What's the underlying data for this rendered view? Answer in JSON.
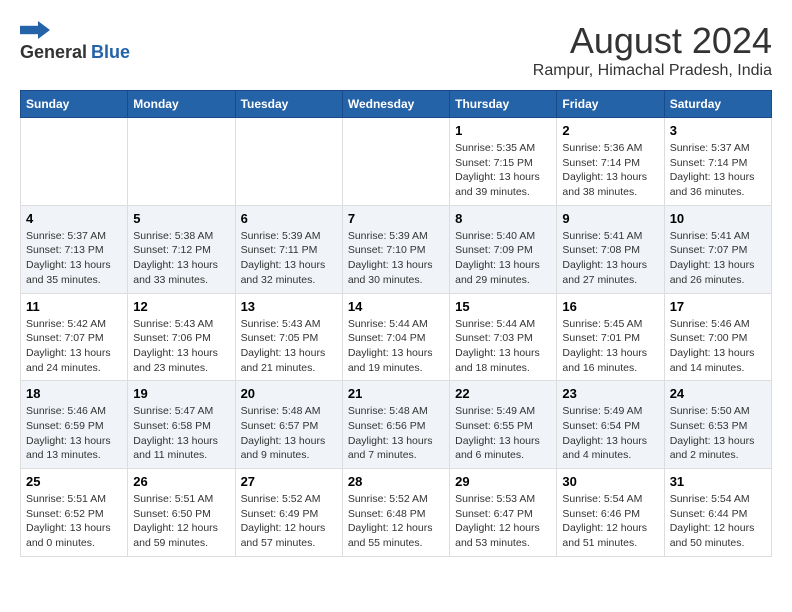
{
  "logo": {
    "general": "General",
    "blue": "Blue"
  },
  "title": "August 2024",
  "subtitle": "Rampur, Himachal Pradesh, India",
  "days_of_week": [
    "Sunday",
    "Monday",
    "Tuesday",
    "Wednesday",
    "Thursday",
    "Friday",
    "Saturday"
  ],
  "weeks": [
    {
      "days": [
        {
          "number": "",
          "sunrise": "",
          "sunset": "",
          "daylight": ""
        },
        {
          "number": "",
          "sunrise": "",
          "sunset": "",
          "daylight": ""
        },
        {
          "number": "",
          "sunrise": "",
          "sunset": "",
          "daylight": ""
        },
        {
          "number": "",
          "sunrise": "",
          "sunset": "",
          "daylight": ""
        },
        {
          "number": "1",
          "sunrise": "Sunrise: 5:35 AM",
          "sunset": "Sunset: 7:15 PM",
          "daylight": "Daylight: 13 hours and 39 minutes."
        },
        {
          "number": "2",
          "sunrise": "Sunrise: 5:36 AM",
          "sunset": "Sunset: 7:14 PM",
          "daylight": "Daylight: 13 hours and 38 minutes."
        },
        {
          "number": "3",
          "sunrise": "Sunrise: 5:37 AM",
          "sunset": "Sunset: 7:14 PM",
          "daylight": "Daylight: 13 hours and 36 minutes."
        }
      ]
    },
    {
      "days": [
        {
          "number": "4",
          "sunrise": "Sunrise: 5:37 AM",
          "sunset": "Sunset: 7:13 PM",
          "daylight": "Daylight: 13 hours and 35 minutes."
        },
        {
          "number": "5",
          "sunrise": "Sunrise: 5:38 AM",
          "sunset": "Sunset: 7:12 PM",
          "daylight": "Daylight: 13 hours and 33 minutes."
        },
        {
          "number": "6",
          "sunrise": "Sunrise: 5:39 AM",
          "sunset": "Sunset: 7:11 PM",
          "daylight": "Daylight: 13 hours and 32 minutes."
        },
        {
          "number": "7",
          "sunrise": "Sunrise: 5:39 AM",
          "sunset": "Sunset: 7:10 PM",
          "daylight": "Daylight: 13 hours and 30 minutes."
        },
        {
          "number": "8",
          "sunrise": "Sunrise: 5:40 AM",
          "sunset": "Sunset: 7:09 PM",
          "daylight": "Daylight: 13 hours and 29 minutes."
        },
        {
          "number": "9",
          "sunrise": "Sunrise: 5:41 AM",
          "sunset": "Sunset: 7:08 PM",
          "daylight": "Daylight: 13 hours and 27 minutes."
        },
        {
          "number": "10",
          "sunrise": "Sunrise: 5:41 AM",
          "sunset": "Sunset: 7:07 PM",
          "daylight": "Daylight: 13 hours and 26 minutes."
        }
      ]
    },
    {
      "days": [
        {
          "number": "11",
          "sunrise": "Sunrise: 5:42 AM",
          "sunset": "Sunset: 7:07 PM",
          "daylight": "Daylight: 13 hours and 24 minutes."
        },
        {
          "number": "12",
          "sunrise": "Sunrise: 5:43 AM",
          "sunset": "Sunset: 7:06 PM",
          "daylight": "Daylight: 13 hours and 23 minutes."
        },
        {
          "number": "13",
          "sunrise": "Sunrise: 5:43 AM",
          "sunset": "Sunset: 7:05 PM",
          "daylight": "Daylight: 13 hours and 21 minutes."
        },
        {
          "number": "14",
          "sunrise": "Sunrise: 5:44 AM",
          "sunset": "Sunset: 7:04 PM",
          "daylight": "Daylight: 13 hours and 19 minutes."
        },
        {
          "number": "15",
          "sunrise": "Sunrise: 5:44 AM",
          "sunset": "Sunset: 7:03 PM",
          "daylight": "Daylight: 13 hours and 18 minutes."
        },
        {
          "number": "16",
          "sunrise": "Sunrise: 5:45 AM",
          "sunset": "Sunset: 7:01 PM",
          "daylight": "Daylight: 13 hours and 16 minutes."
        },
        {
          "number": "17",
          "sunrise": "Sunrise: 5:46 AM",
          "sunset": "Sunset: 7:00 PM",
          "daylight": "Daylight: 13 hours and 14 minutes."
        }
      ]
    },
    {
      "days": [
        {
          "number": "18",
          "sunrise": "Sunrise: 5:46 AM",
          "sunset": "Sunset: 6:59 PM",
          "daylight": "Daylight: 13 hours and 13 minutes."
        },
        {
          "number": "19",
          "sunrise": "Sunrise: 5:47 AM",
          "sunset": "Sunset: 6:58 PM",
          "daylight": "Daylight: 13 hours and 11 minutes."
        },
        {
          "number": "20",
          "sunrise": "Sunrise: 5:48 AM",
          "sunset": "Sunset: 6:57 PM",
          "daylight": "Daylight: 13 hours and 9 minutes."
        },
        {
          "number": "21",
          "sunrise": "Sunrise: 5:48 AM",
          "sunset": "Sunset: 6:56 PM",
          "daylight": "Daylight: 13 hours and 7 minutes."
        },
        {
          "number": "22",
          "sunrise": "Sunrise: 5:49 AM",
          "sunset": "Sunset: 6:55 PM",
          "daylight": "Daylight: 13 hours and 6 minutes."
        },
        {
          "number": "23",
          "sunrise": "Sunrise: 5:49 AM",
          "sunset": "Sunset: 6:54 PM",
          "daylight": "Daylight: 13 hours and 4 minutes."
        },
        {
          "number": "24",
          "sunrise": "Sunrise: 5:50 AM",
          "sunset": "Sunset: 6:53 PM",
          "daylight": "Daylight: 13 hours and 2 minutes."
        }
      ]
    },
    {
      "days": [
        {
          "number": "25",
          "sunrise": "Sunrise: 5:51 AM",
          "sunset": "Sunset: 6:52 PM",
          "daylight": "Daylight: 13 hours and 0 minutes."
        },
        {
          "number": "26",
          "sunrise": "Sunrise: 5:51 AM",
          "sunset": "Sunset: 6:50 PM",
          "daylight": "Daylight: 12 hours and 59 minutes."
        },
        {
          "number": "27",
          "sunrise": "Sunrise: 5:52 AM",
          "sunset": "Sunset: 6:49 PM",
          "daylight": "Daylight: 12 hours and 57 minutes."
        },
        {
          "number": "28",
          "sunrise": "Sunrise: 5:52 AM",
          "sunset": "Sunset: 6:48 PM",
          "daylight": "Daylight: 12 hours and 55 minutes."
        },
        {
          "number": "29",
          "sunrise": "Sunrise: 5:53 AM",
          "sunset": "Sunset: 6:47 PM",
          "daylight": "Daylight: 12 hours and 53 minutes."
        },
        {
          "number": "30",
          "sunrise": "Sunrise: 5:54 AM",
          "sunset": "Sunset: 6:46 PM",
          "daylight": "Daylight: 12 hours and 51 minutes."
        },
        {
          "number": "31",
          "sunrise": "Sunrise: 5:54 AM",
          "sunset": "Sunset: 6:44 PM",
          "daylight": "Daylight: 12 hours and 50 minutes."
        }
      ]
    }
  ]
}
